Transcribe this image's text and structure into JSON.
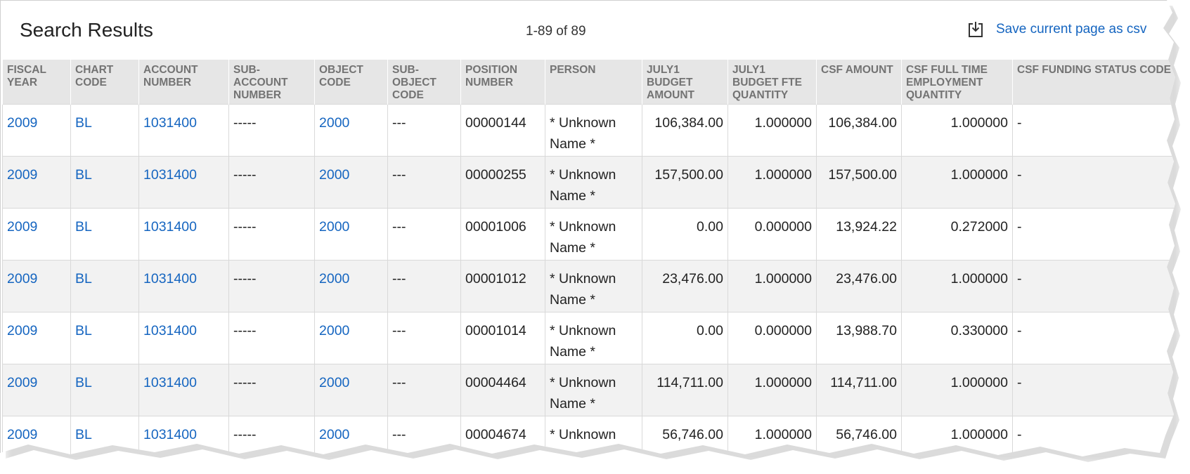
{
  "header": {
    "title": "Search Results",
    "pager": "1-89 of 89",
    "csv_label": "Save current page as csv",
    "csv_icon": "download-icon"
  },
  "colors": {
    "link": "#1565c0",
    "header_bg": "#e6e6e6",
    "stripe": "#f2f2f2"
  },
  "columns": [
    "FISCAL YEAR",
    "CHART CODE",
    "ACCOUNT NUMBER",
    "SUB-ACCOUNT NUMBER",
    "OBJECT CODE",
    "SUB-OBJECT CODE",
    "POSITION NUMBER",
    "PERSON",
    "JULY1 BUDGET AMOUNT",
    "JULY1 BUDGET FTE QUANTITY",
    "CSF AMOUNT",
    "CSF FULL TIME EMPLOYMENT QUANTITY",
    "CSF FUNDING STATUS CODE"
  ],
  "rows": [
    [
      "2009",
      "BL",
      "1031400",
      "-----",
      "2000",
      "---",
      "00000144",
      "* Unknown Name *",
      "106,384.00",
      "1.000000",
      "106,384.00",
      "1.000000",
      "-"
    ],
    [
      "2009",
      "BL",
      "1031400",
      "-----",
      "2000",
      "---",
      "00000255",
      "* Unknown Name *",
      "157,500.00",
      "1.000000",
      "157,500.00",
      "1.000000",
      "-"
    ],
    [
      "2009",
      "BL",
      "1031400",
      "-----",
      "2000",
      "---",
      "00001006",
      "* Unknown Name *",
      "0.00",
      "0.000000",
      "13,924.22",
      "0.272000",
      "-"
    ],
    [
      "2009",
      "BL",
      "1031400",
      "-----",
      "2000",
      "---",
      "00001012",
      "* Unknown Name *",
      "23,476.00",
      "1.000000",
      "23,476.00",
      "1.000000",
      "-"
    ],
    [
      "2009",
      "BL",
      "1031400",
      "-----",
      "2000",
      "---",
      "00001014",
      "* Unknown Name *",
      "0.00",
      "0.000000",
      "13,988.70",
      "0.330000",
      "-"
    ],
    [
      "2009",
      "BL",
      "1031400",
      "-----",
      "2000",
      "---",
      "00004464",
      "* Unknown Name *",
      "114,711.00",
      "1.000000",
      "114,711.00",
      "1.000000",
      "-"
    ],
    [
      "2009",
      "BL",
      "1031400",
      "-----",
      "2000",
      "---",
      "00004674",
      "* Unknown Name *",
      "56,746.00",
      "1.000000",
      "56,746.00",
      "1.000000",
      "-"
    ]
  ]
}
